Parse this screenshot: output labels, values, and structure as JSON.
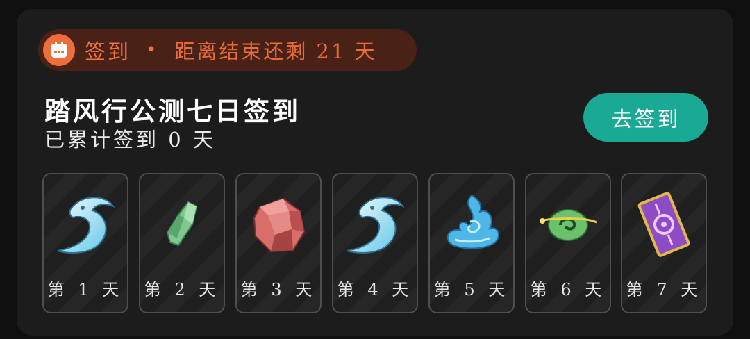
{
  "header": {
    "badge_label": "签到",
    "separator": "•",
    "countdown": "距离结束还剩 21 天"
  },
  "main": {
    "title": "踏风行公测七日签到",
    "subtitle": "已累计签到 0 天",
    "button_label": "去签到"
  },
  "days": [
    {
      "label": "第 1 天",
      "icon": "wind-feather-icon"
    },
    {
      "label": "第 2 天",
      "icon": "green-crystal-icon"
    },
    {
      "label": "第 3 天",
      "icon": "red-ore-icon"
    },
    {
      "label": "第 4 天",
      "icon": "wind-feather-icon"
    },
    {
      "label": "第 5 天",
      "icon": "blue-flame-icon"
    },
    {
      "label": "第 6 天",
      "icon": "green-swirl-orb-icon"
    },
    {
      "label": "第 7 天",
      "icon": "purple-ticket-icon"
    }
  ],
  "colors": {
    "accent_orange": "#f07443",
    "button_teal": "#19a995",
    "card_bg": "#1c1c1d"
  }
}
